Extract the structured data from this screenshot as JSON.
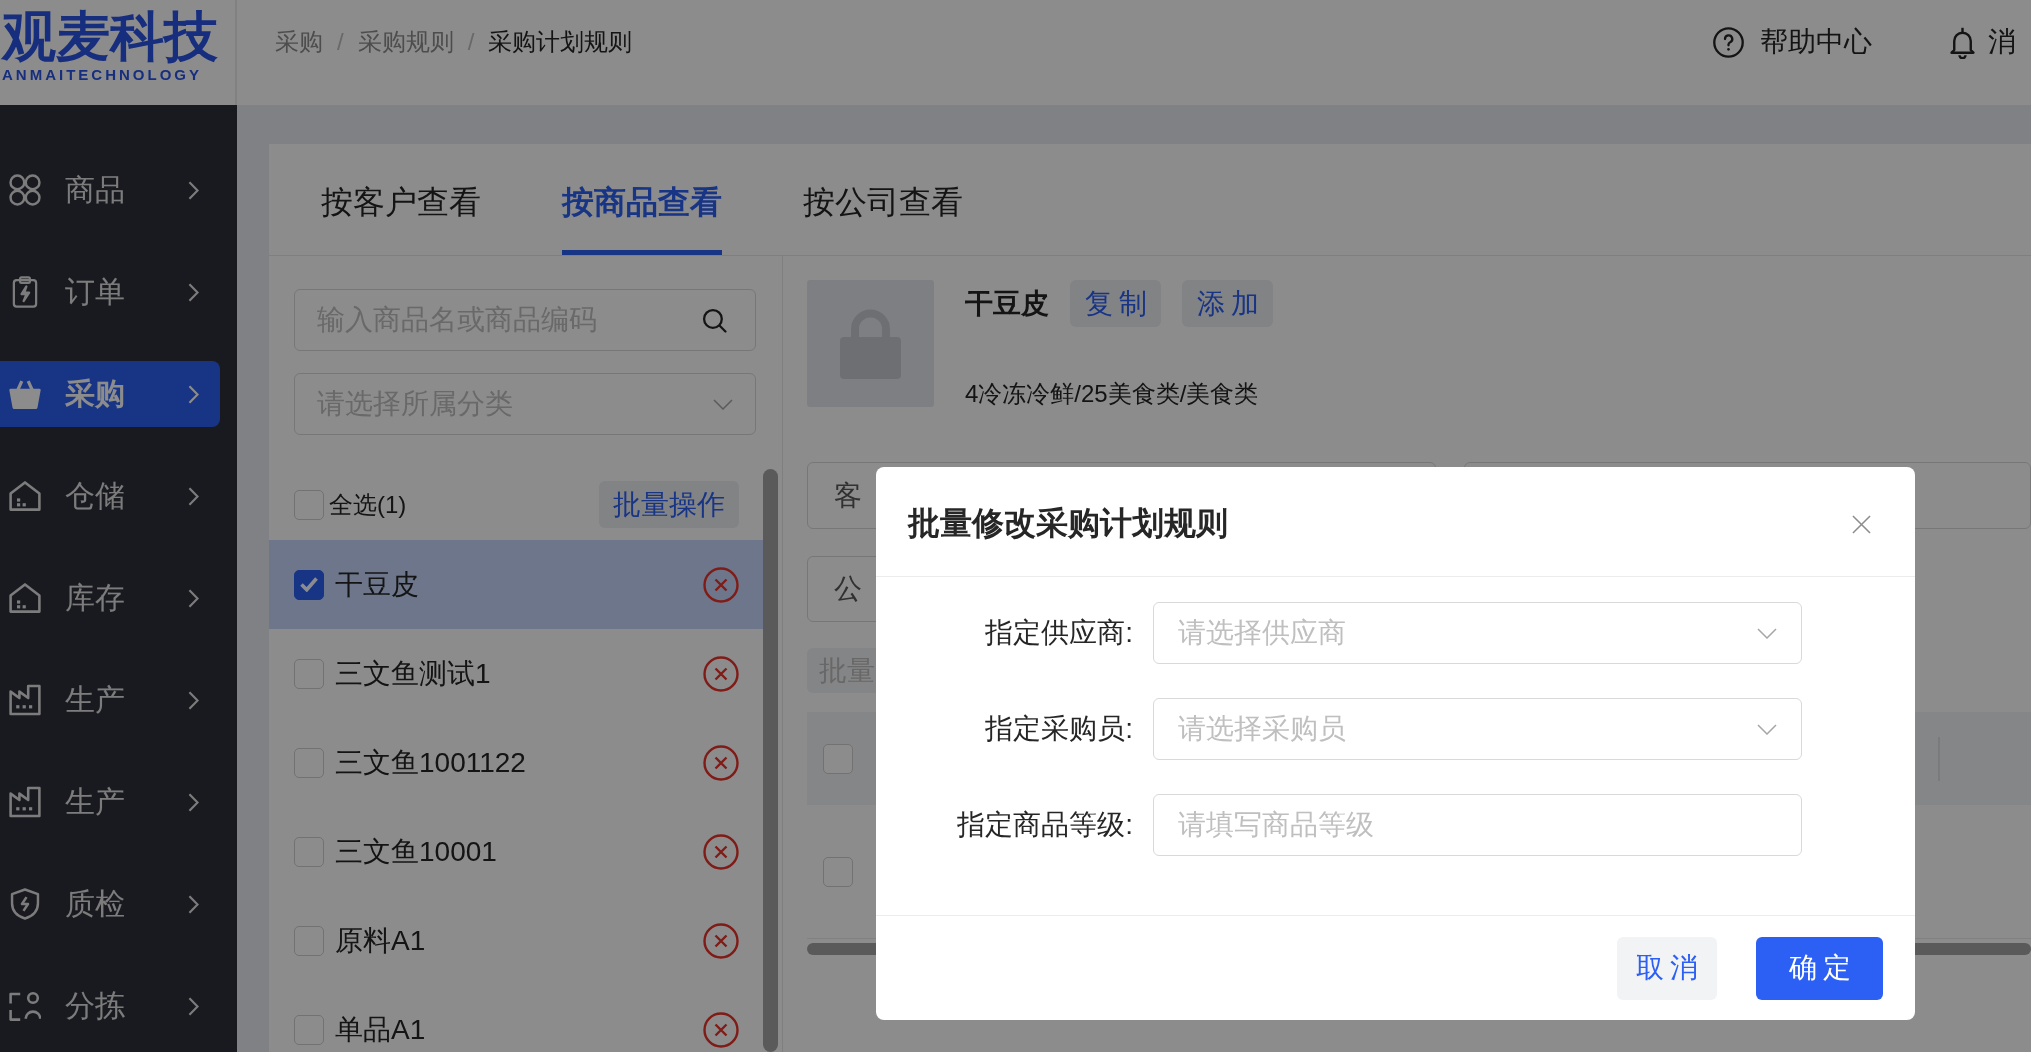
{
  "header": {
    "logo": {
      "wordmark": "观麦科技",
      "tagline": "ANMAITECHNOLOGY"
    },
    "breadcrumb": [
      {
        "label": "采购",
        "separator": "/",
        "current": false
      },
      {
        "label": "采购规则",
        "separator": "/",
        "current": false
      },
      {
        "label": "采购计划规则",
        "current": true
      }
    ],
    "actions": [
      {
        "kind": "help",
        "label": "帮助中心"
      },
      {
        "kind": "messages",
        "label": "消"
      }
    ]
  },
  "sidebar": {
    "items": [
      {
        "label": "商品",
        "selected": false
      },
      {
        "label": "订单",
        "selected": false
      },
      {
        "label": "采购",
        "selected": true
      },
      {
        "label": "仓储",
        "selected": false
      },
      {
        "label": "库存",
        "selected": false
      },
      {
        "label": "生产",
        "selected": false
      },
      {
        "label": "生产",
        "selected": false
      },
      {
        "label": "质检",
        "selected": false
      },
      {
        "label": "分拣",
        "selected": false
      }
    ]
  },
  "tabs": [
    {
      "label": "按客户查看",
      "selected": false
    },
    {
      "label": "按商品查看",
      "selected": true
    },
    {
      "label": "按公司查看",
      "selected": false
    }
  ],
  "product_panel": {
    "search": {
      "placeholder": "输入商品名或商品编码"
    },
    "category": {
      "placeholder": "请选择所属分类"
    },
    "select_all": {
      "label": "全选(1)",
      "checked": false
    },
    "batch_button": "批量操作",
    "products": [
      {
        "name": "干豆皮",
        "checked": true,
        "selected": true
      },
      {
        "name": "三文鱼测试1",
        "checked": false,
        "selected": false
      },
      {
        "name": "三文鱼1001122",
        "checked": false,
        "selected": false
      },
      {
        "name": "三文鱼10001",
        "checked": false,
        "selected": false
      },
      {
        "name": "原料A1",
        "checked": false,
        "selected": false
      },
      {
        "name": "单品A1",
        "checked": false,
        "selected": false
      }
    ]
  },
  "detail": {
    "name": "干豆皮",
    "actions": [
      "复制",
      "添加"
    ],
    "category_path": "4冷冻冷鲜/25美食类/美食类",
    "filters": [
      {
        "label": "客"
      },
      {
        "label": "公"
      }
    ],
    "batch_button": {
      "label": "批量",
      "disabled": true
    },
    "table": {
      "header_checked": false,
      "rows": [
        {
          "checked": false
        }
      ]
    }
  },
  "dialog": {
    "title": "批量修改采购计划规则",
    "fields": [
      {
        "kind": "select",
        "label": "指定供应商:",
        "placeholder": "请选择供应商"
      },
      {
        "kind": "select",
        "label": "指定采购员:",
        "placeholder": "请选择采购员"
      },
      {
        "kind": "input",
        "label": "指定商品等级:",
        "placeholder": "请填写商品等级"
      }
    ],
    "buttons": [
      {
        "kind": "secondary",
        "label": "取消"
      },
      {
        "kind": "primary",
        "label": "确定"
      }
    ]
  }
}
